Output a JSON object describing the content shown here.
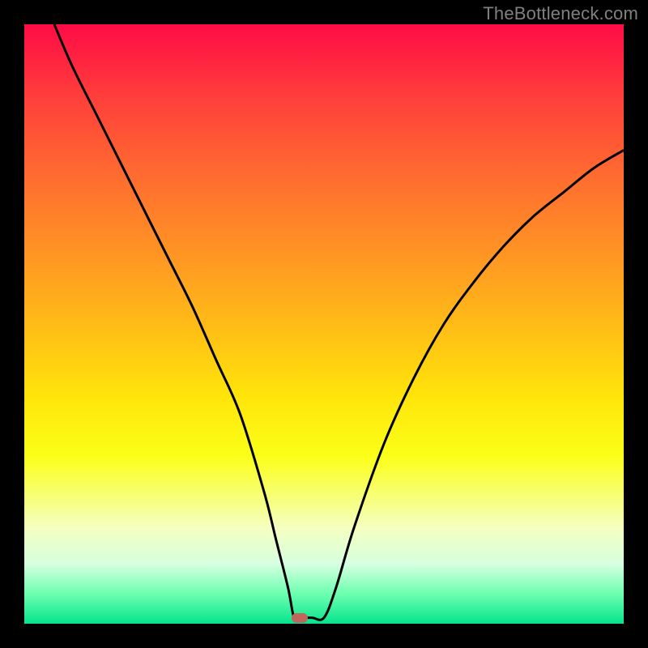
{
  "watermark": "TheBottleneck.com",
  "colors": {
    "frame": "#000000",
    "curve": "#000000",
    "marker": "#c1665a"
  },
  "chart_data": {
    "type": "line",
    "title": "",
    "xlabel": "",
    "ylabel": "",
    "xlim": [
      0,
      100
    ],
    "ylim": [
      0,
      100
    ],
    "grid": false,
    "legend": false,
    "series": [
      {
        "name": "bottleneck-curve",
        "x": [
          5,
          8,
          12,
          16,
          20,
          24,
          28,
          32,
          36,
          40,
          42,
          44,
          45,
          46,
          48,
          50,
          52,
          55,
          60,
          65,
          70,
          75,
          80,
          85,
          90,
          95,
          100
        ],
        "values": [
          100,
          93,
          85,
          77,
          69,
          61,
          53,
          44,
          35,
          22,
          14,
          6,
          1,
          1,
          1,
          1,
          6,
          16,
          30,
          41,
          50,
          57,
          63,
          68,
          72,
          76,
          79
        ]
      }
    ],
    "marker": {
      "x": 46,
      "y": 1
    },
    "gradient_stops": [
      {
        "pos": 0,
        "color": "#ff0b46"
      },
      {
        "pos": 12,
        "color": "#ff3e3b"
      },
      {
        "pos": 26,
        "color": "#ff6e2f"
      },
      {
        "pos": 40,
        "color": "#ff9a22"
      },
      {
        "pos": 52,
        "color": "#ffc215"
      },
      {
        "pos": 62,
        "color": "#ffe40a"
      },
      {
        "pos": 72,
        "color": "#fbff18"
      },
      {
        "pos": 84,
        "color": "#f5ffc0"
      },
      {
        "pos": 90,
        "color": "#d7ffe0"
      },
      {
        "pos": 95,
        "color": "#6dffb0"
      },
      {
        "pos": 100,
        "color": "#06e48d"
      }
    ]
  }
}
